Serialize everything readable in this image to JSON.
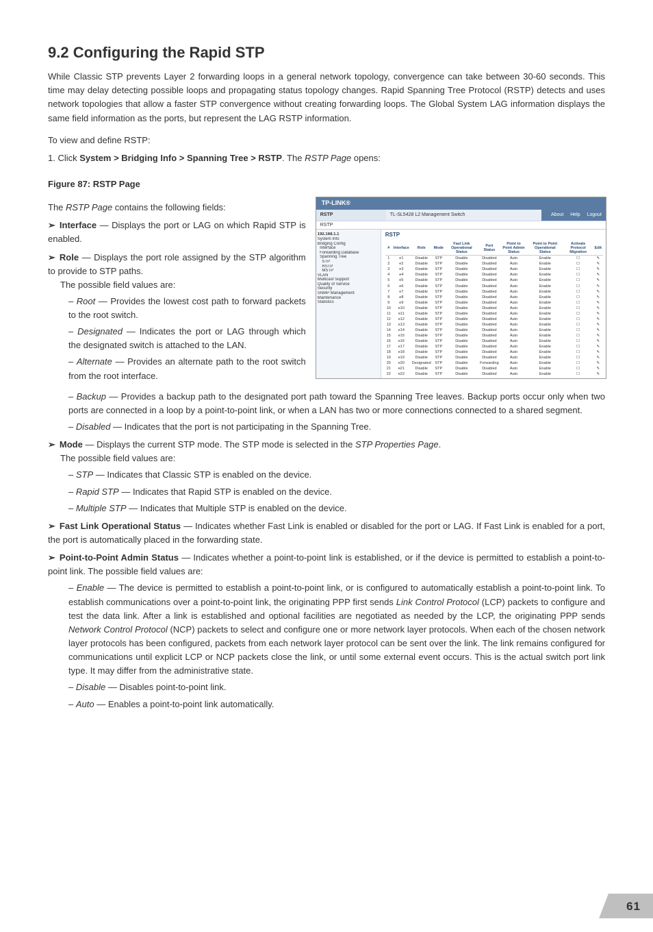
{
  "heading": "9.2  Configuring the Rapid STP",
  "intro": "While Classic STP prevents Layer 2 forwarding loops in a general network topology, convergence can take between 30-60 seconds. This time may delay detecting possible loops and propagating status topology changes. Rapid Spanning Tree Protocol (RSTP) detects and uses network topologies that allow a faster STP convergence without creating forwarding loops. The Global System LAG information displays the same field information as the ports, but represent the LAG RSTP information.",
  "to_view": "To view and define RSTP:",
  "step1_pre": "1.  Click ",
  "step1_path": "System > Bridging Info > Spanning Tree > RSTP",
  "step1_post": ". The ",
  "step1_page": "RSTP Page",
  "step1_end": " opens:",
  "fig_caption": "Figure 87: RSTP Page",
  "contains_pre": "The ",
  "contains_page": "RSTP Page",
  "contains_post": " contains the following fields:",
  "li_interface_label": "Interface",
  "li_interface_text": " — Displays the port or LAG on which Rapid STP is enabled.",
  "li_role_label": "Role",
  "li_role_text": " — Displays the port role assigned by the STP algorithm to provide to STP paths.",
  "li_role_possible": "The possible field values are:",
  "role_root_label": "Root",
  "role_root_text": " — Provides the lowest cost path to forward packets to the root switch.",
  "role_designated_label": "Designated",
  "role_designated_text": " — Indicates the port or LAG through which the designated switch is attached to the LAN.",
  "role_alternate_label": "Alternate",
  "role_alternate_text": " — Provides an alternate path to the root switch from the root interface.",
  "role_backup_label": "Backup",
  "role_backup_text": " — Provides a backup path to the designated port path toward the Spanning Tree leaves. Backup ports occur only when two ports are connected in a loop by a point-to-point link, or when a LAN has two or more connections connected to a shared segment.",
  "role_disabled_label": "Disabled",
  "role_disabled_text": " — Indicates that the port is not participating in the Spanning Tree.",
  "li_mode_label": "Mode",
  "li_mode_text_pre": " — Displays the current STP mode. The STP mode is selected in the ",
  "li_mode_text_page": "STP Properties Page",
  "li_mode_text_post": ".",
  "li_mode_possible": "The possible field values are:",
  "mode_stp_label": "STP",
  "mode_stp_text": " — Indicates that Classic STP is enabled on the device.",
  "mode_rstp_label": "Rapid STP",
  "mode_rstp_text": " — Indicates that Rapid STP is enabled on the device.",
  "mode_mstp_label": "Multiple STP",
  "mode_mstp_text": " — Indicates that Multiple STP is enabled on the device.",
  "li_fastlink_label": "Fast Link Operational Status",
  "li_fastlink_text": " — Indicates whether Fast Link is enabled or disabled for the port or LAG. If Fast Link is enabled for a port, the port is automatically placed in the forwarding state.",
  "li_p2p_label": "Point-to-Point Admin Status",
  "li_p2p_text": " — Indicates whether a point-to-point link is established, or if the device is permitted to establish a point-to-point link. The possible field values are:",
  "p2p_enable_label": "Enable",
  "p2p_enable_text_1": " — The device is permitted to establish a point-to-point link, or is configured to automatically establish a point-to-point link. To establish communications over a point-to-point link, the originating PPP first sends ",
  "p2p_enable_lcp": "Link Control Protocol",
  "p2p_enable_text_2": " (LCP) packets to configure and test the data link. After a link is established and optional facilities are negotiated as needed by the LCP, the originating PPP sends ",
  "p2p_enable_ncp": "Network Control Protocol",
  "p2p_enable_text_3": " (NCP) packets to select and configure one or more network layer protocols. When each of the chosen network layer protocols has been configured, packets from each network layer protocol can be sent over the link. The link remains configured for communications until explicit LCP or NCP packets close the link, or until some external event occurs. This is the actual switch port link type. It may differ from the administrative state.",
  "p2p_disable_label": "Disable",
  "p2p_disable_text": " — Disables point-to-point link.",
  "p2p_auto_label": "Auto",
  "p2p_auto_text": " — Enables a point-to-point link automatically.",
  "page_number": "61",
  "shot": {
    "brand": "TP-LINK®",
    "device": "TL-SL5428 L2 Management Switch",
    "nav_about": "About",
    "nav_help": "Help",
    "nav_logout": "Logout",
    "panel_label": "RSTP",
    "tab": "RSTP",
    "ip": "192.168.1.1",
    "tree": [
      "System Info",
      "Bridging Config",
      "  Interface",
      "  Forwarding Database",
      "  Spanning Tree",
      "    STP",
      "    RSTP",
      "    MSTP",
      "VLAN",
      "Multicast Support",
      "Quality of Service",
      "Security",
      "SNMP Management",
      "Maintenance",
      "Statistics"
    ],
    "cols": [
      "#",
      "Interface",
      "Role",
      "Mode",
      "Fast Link Operational Status",
      "Port Status",
      "Point to Point Admin Status",
      "Point to Point Operational Status",
      "Activate Protocol Migration",
      "Edit"
    ],
    "rows": [
      [
        "1",
        "e1",
        "Disable",
        "STP",
        "Disable",
        "Disabled",
        "Auto",
        "Enable",
        "☐",
        "✎"
      ],
      [
        "2",
        "e2",
        "Disable",
        "STP",
        "Disable",
        "Disabled",
        "Auto",
        "Enable",
        "☐",
        "✎"
      ],
      [
        "3",
        "e3",
        "Disable",
        "STP",
        "Disable",
        "Disabled",
        "Auto",
        "Enable",
        "☐",
        "✎"
      ],
      [
        "4",
        "e4",
        "Disable",
        "STP",
        "Disable",
        "Disabled",
        "Auto",
        "Enable",
        "☐",
        "✎"
      ],
      [
        "5",
        "e5",
        "Disable",
        "STP",
        "Disable",
        "Disabled",
        "Auto",
        "Enable",
        "☐",
        "✎"
      ],
      [
        "6",
        "e6",
        "Disable",
        "STP",
        "Disable",
        "Disabled",
        "Auto",
        "Enable",
        "☐",
        "✎"
      ],
      [
        "7",
        "e7",
        "Disable",
        "STP",
        "Disable",
        "Disabled",
        "Auto",
        "Enable",
        "☐",
        "✎"
      ],
      [
        "8",
        "e8",
        "Disable",
        "STP",
        "Disable",
        "Disabled",
        "Auto",
        "Enable",
        "☐",
        "✎"
      ],
      [
        "9",
        "e9",
        "Disable",
        "STP",
        "Disable",
        "Disabled",
        "Auto",
        "Enable",
        "☐",
        "✎"
      ],
      [
        "10",
        "e10",
        "Disable",
        "STP",
        "Disable",
        "Disabled",
        "Auto",
        "Enable",
        "☐",
        "✎"
      ],
      [
        "11",
        "e11",
        "Disable",
        "STP",
        "Disable",
        "Disabled",
        "Auto",
        "Enable",
        "☐",
        "✎"
      ],
      [
        "12",
        "e12",
        "Disable",
        "STP",
        "Disable",
        "Disabled",
        "Auto",
        "Enable",
        "☐",
        "✎"
      ],
      [
        "13",
        "e13",
        "Disable",
        "STP",
        "Disable",
        "Disabled",
        "Auto",
        "Enable",
        "☐",
        "✎"
      ],
      [
        "14",
        "e14",
        "Disable",
        "STP",
        "Disable",
        "Disabled",
        "Auto",
        "Enable",
        "☐",
        "✎"
      ],
      [
        "15",
        "e15",
        "Disable",
        "STP",
        "Disable",
        "Disabled",
        "Auto",
        "Enable",
        "☐",
        "✎"
      ],
      [
        "16",
        "e16",
        "Disable",
        "STP",
        "Disable",
        "Disabled",
        "Auto",
        "Enable",
        "☐",
        "✎"
      ],
      [
        "17",
        "e17",
        "Disable",
        "STP",
        "Disable",
        "Disabled",
        "Auto",
        "Enable",
        "☐",
        "✎"
      ],
      [
        "18",
        "e18",
        "Disable",
        "STP",
        "Disable",
        "Disabled",
        "Auto",
        "Enable",
        "☐",
        "✎"
      ],
      [
        "19",
        "e19",
        "Disable",
        "STP",
        "Disable",
        "Disabled",
        "Auto",
        "Enable",
        "☐",
        "✎"
      ],
      [
        "20",
        "e20",
        "Designated",
        "STP",
        "Disable",
        "Forwarding",
        "Auto",
        "Enable",
        "☐",
        "✎"
      ],
      [
        "21",
        "e21",
        "Disable",
        "STP",
        "Disable",
        "Disabled",
        "Auto",
        "Enable",
        "☐",
        "✎"
      ],
      [
        "22",
        "e22",
        "Disable",
        "STP",
        "Disable",
        "Disabled",
        "Auto",
        "Enable",
        "☐",
        "✎"
      ]
    ]
  }
}
